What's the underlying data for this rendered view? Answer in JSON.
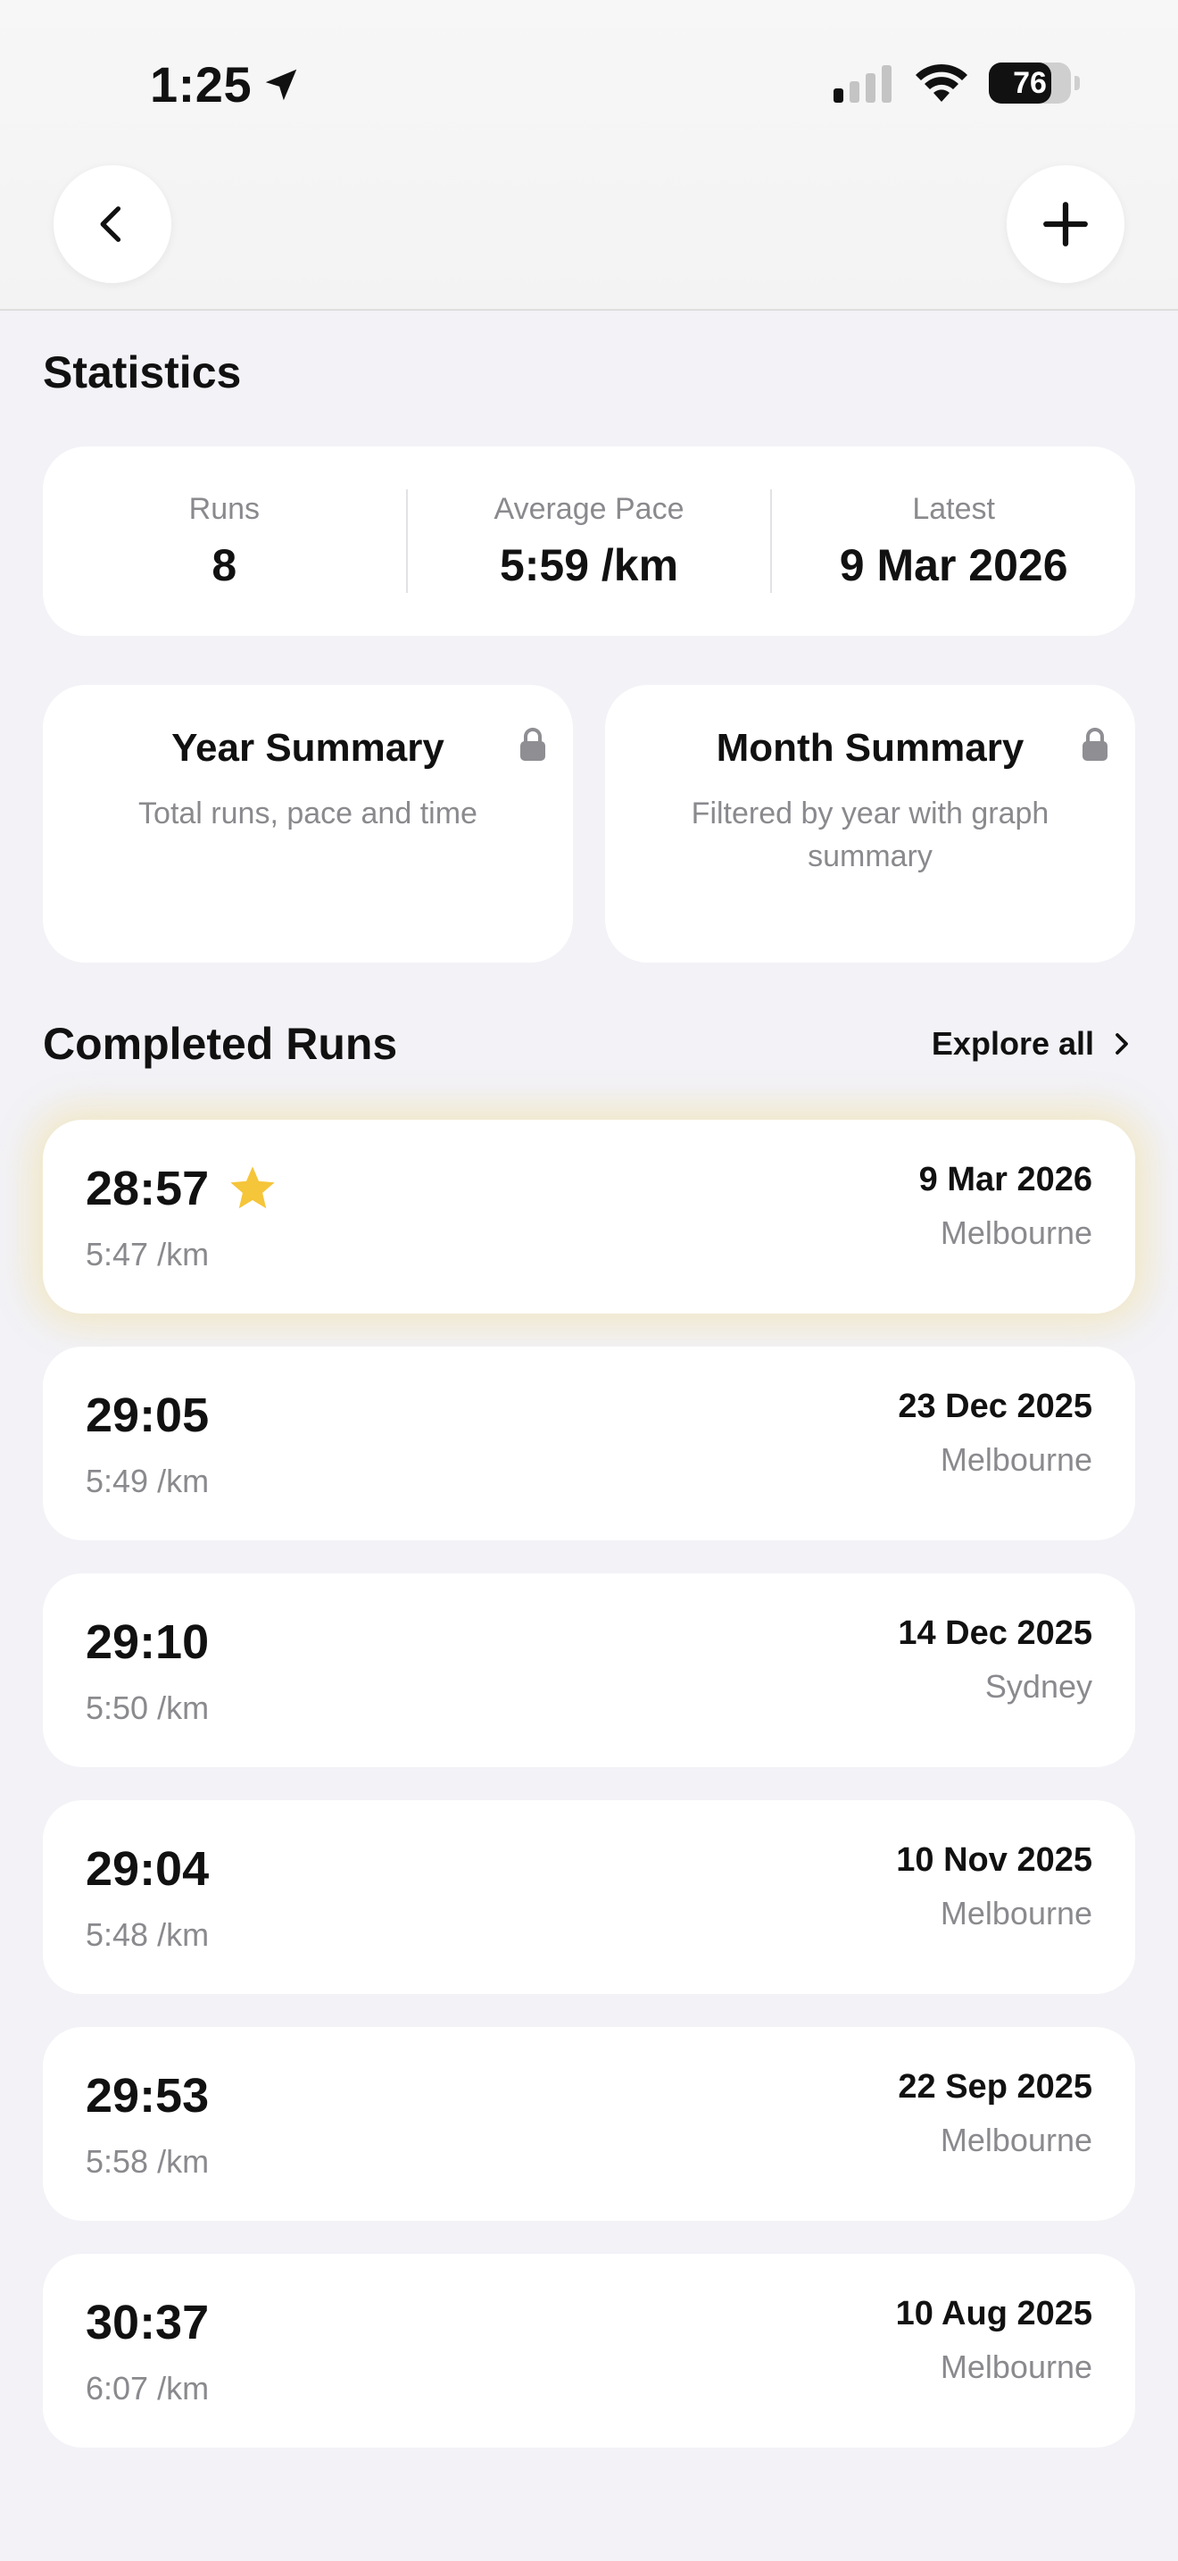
{
  "status": {
    "time": "1:25",
    "battery": "76"
  },
  "statistics": {
    "title": "Statistics",
    "runs_label": "Runs",
    "runs_value": "8",
    "pace_label": "Average Pace",
    "pace_value": "5:59 /km",
    "latest_label": "Latest",
    "latest_value": "9 Mar 2026"
  },
  "summaries": {
    "year_title": "Year Summary",
    "year_desc": "Total runs, pace and time",
    "month_title": "Month Summary",
    "month_desc": "Filtered by year with graph summary"
  },
  "completed": {
    "title": "Completed Runs",
    "explore_label": "Explore all",
    "runs": [
      {
        "time": "28:57",
        "pace": "5:47 /km",
        "date": "9 Mar 2026",
        "city": "Melbourne",
        "starred": true
      },
      {
        "time": "29:05",
        "pace": "5:49 /km",
        "date": "23 Dec 2025",
        "city": "Melbourne",
        "starred": false
      },
      {
        "time": "29:10",
        "pace": "5:50 /km",
        "date": "14 Dec 2025",
        "city": "Sydney",
        "starred": false
      },
      {
        "time": "29:04",
        "pace": "5:48 /km",
        "date": "10 Nov 2025",
        "city": "Melbourne",
        "starred": false
      },
      {
        "time": "29:53",
        "pace": "5:58 /km",
        "date": "22 Sep 2025",
        "city": "Melbourne",
        "starred": false
      },
      {
        "time": "30:37",
        "pace": "6:07 /km",
        "date": "10 Aug 2025",
        "city": "Melbourne",
        "starred": false
      }
    ]
  },
  "colors": {
    "star": "#f5c53a",
    "highlight_glow": "#f0d25a",
    "background": "#f2f2f7",
    "card": "#ffffff",
    "secondary_text": "#8a8a8e"
  },
  "icons": [
    "location-arrow-icon",
    "signal-icon",
    "wifi-icon",
    "battery-icon",
    "chevron-left-icon",
    "plus-icon",
    "lock-icon",
    "chevron-right-icon",
    "star-icon"
  ]
}
